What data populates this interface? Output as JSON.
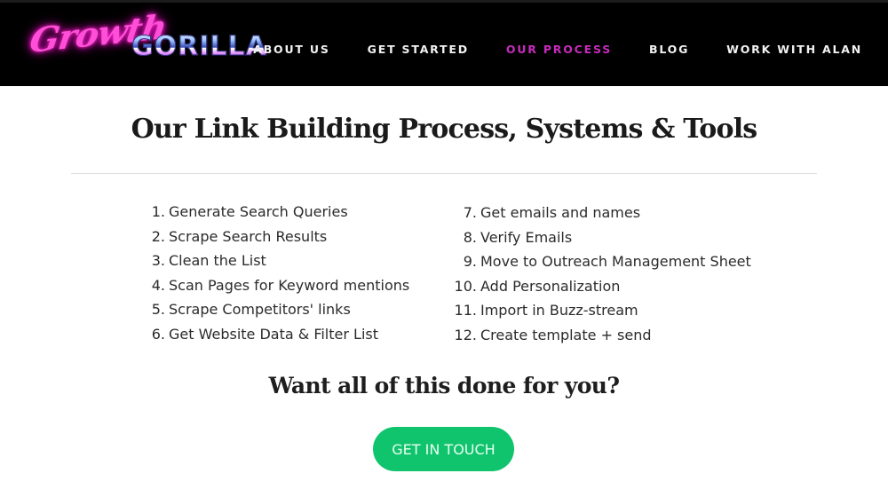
{
  "header": {
    "logo": {
      "script_text": "Growth",
      "block_text": "GORILLA",
      "colors": {
        "script": "#ff4fd8",
        "chrome": "#9fc3ff"
      }
    },
    "nav": [
      {
        "label": "ABOUT US",
        "active": false
      },
      {
        "label": "GET STARTED",
        "active": false
      },
      {
        "label": "OUR PROCESS",
        "active": true
      },
      {
        "label": "BLOG",
        "active": false
      },
      {
        "label": "WORK WITH ALAN",
        "active": false
      }
    ],
    "colors": {
      "background": "#000000",
      "nav_text": "#f2f2f2",
      "nav_active": "#c72bbd"
    }
  },
  "main": {
    "title": "Our Link Building Process, Systems & Tools",
    "steps_left": [
      {
        "num": "1.",
        "label": "Generate Search Queries"
      },
      {
        "num": "2.",
        "label": "Scrape Search Results"
      },
      {
        "num": "3.",
        "label": "Clean the List"
      },
      {
        "num": "4.",
        "label": "Scan Pages for Keyword mentions"
      },
      {
        "num": "5.",
        "label": "Scrape Competitors' links"
      },
      {
        "num": "6.",
        "label": "Get Website Data & Filter List"
      }
    ],
    "steps_right": [
      {
        "num": "7.",
        "label": "Get emails and names"
      },
      {
        "num": "8.",
        "label": "Verify Emails"
      },
      {
        "num": "9.",
        "label": "Move to Outreach Management Sheet"
      },
      {
        "num": "10.",
        "label": "Add Personalization"
      },
      {
        "num": "11.",
        "label": "Import in Buzz-stream"
      },
      {
        "num": "12.",
        "label": "Create template + send"
      }
    ],
    "cta": {
      "heading": "Want all of this done for you?",
      "button_label": "GET IN TOUCH",
      "button_color": "#10c46d"
    }
  }
}
